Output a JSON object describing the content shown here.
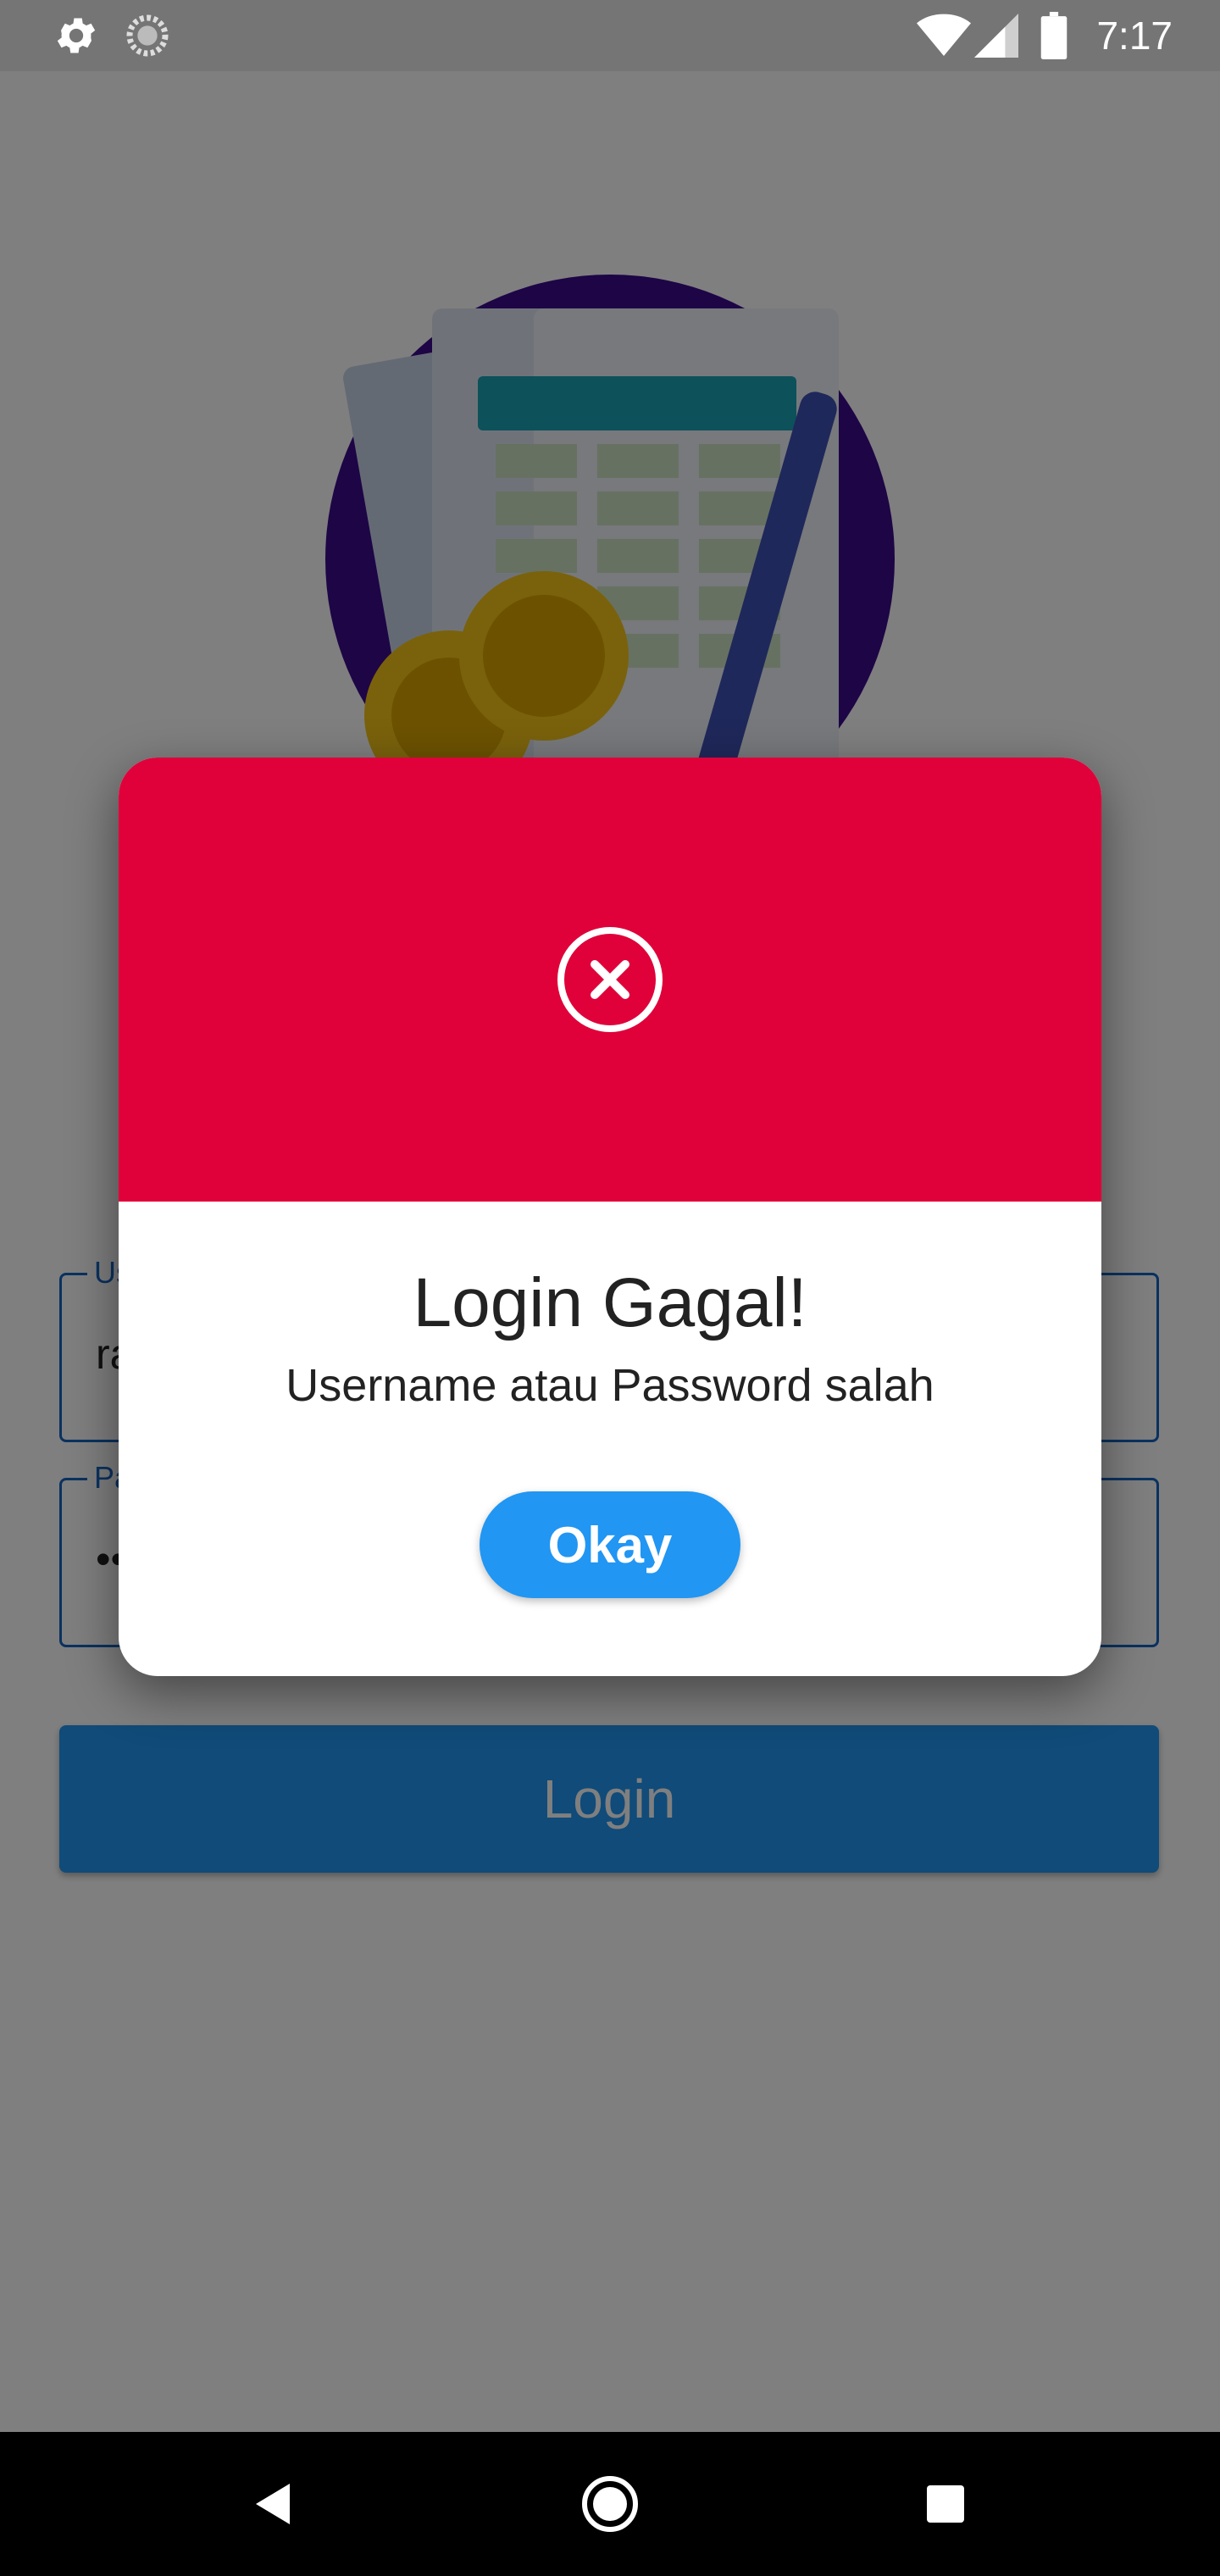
{
  "status_bar": {
    "time": "7:17",
    "icons": [
      "settings-icon",
      "sync-icon",
      "wifi-icon",
      "signal-icon",
      "battery-icon"
    ]
  },
  "login_form": {
    "username_label": "Username",
    "username_value": "ra",
    "password_label": "Password",
    "password_value": "••",
    "login_label": "Login"
  },
  "dialog": {
    "icon": "error-x-icon",
    "title": "Login Gagal!",
    "message": "Username atau Password salah",
    "ok_label": "Okay"
  },
  "nav_bar": {
    "buttons": [
      "back-icon",
      "home-icon",
      "recents-icon"
    ]
  },
  "colors": {
    "dialog_header": "#e0003a",
    "button_blue": "#2196f3",
    "field_border": "#1565c0",
    "illustration_circle": "#3b0a8c",
    "coin": "#f5c518",
    "pen": "#3f51b5"
  }
}
